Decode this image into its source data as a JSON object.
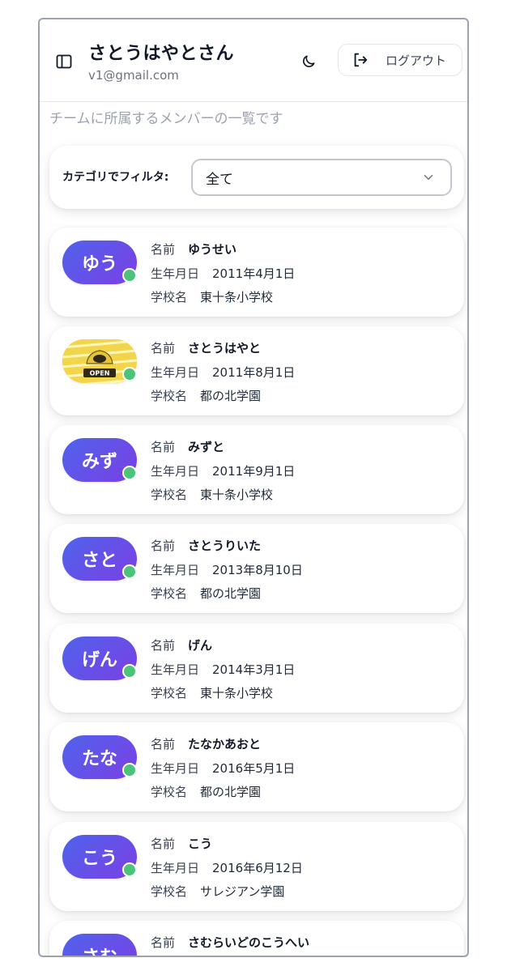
{
  "header": {
    "user_name": "さとうはやとさん",
    "user_email": "v1@gmail.com",
    "logout_label": "ログアウト",
    "sidebar_toggle_icon": "sidebar-panel-icon",
    "theme_icon": "moon-icon",
    "logout_icon": "logout-icon"
  },
  "subtitle": "チームに所属するメンバーの一覧です",
  "filter": {
    "label": "カテゴリでフィルタ:",
    "selected": "全て"
  },
  "labels": {
    "name": "名前",
    "birthday": "生年月日",
    "school": "学校名"
  },
  "colors": {
    "avatar_gradient_start": "#4f63ec",
    "avatar_gradient_end": "#7b3fe4",
    "status_online": "#4cc37a"
  },
  "members": [
    {
      "avatar_text": "ゆう",
      "name": "ゆうせい",
      "birthday": "2011年4月1日",
      "school": "東十条小学校"
    },
    {
      "avatar_text": "",
      "avatar_image": "open-sign-image",
      "avatar_image_text": "OPEN",
      "name": "さとうはやと",
      "birthday": "2011年8月1日",
      "school": "都の北学園"
    },
    {
      "avatar_text": "みず",
      "name": "みずと",
      "birthday": "2011年9月1日",
      "school": "東十条小学校"
    },
    {
      "avatar_text": "さと",
      "name": "さとうりいた",
      "birthday": "2013年8月10日",
      "school": "都の北学園"
    },
    {
      "avatar_text": "げん",
      "name": "げん",
      "birthday": "2014年3月1日",
      "school": "東十条小学校"
    },
    {
      "avatar_text": "たな",
      "name": "たなかあおと",
      "birthday": "2016年5月1日",
      "school": "都の北学園"
    },
    {
      "avatar_text": "こう",
      "name": "こう",
      "birthday": "2016年6月12日",
      "school": "サレジアン学園"
    },
    {
      "avatar_text": "さむ",
      "name": "さむらいどのこうへい",
      "birthday": "",
      "school": ""
    }
  ]
}
